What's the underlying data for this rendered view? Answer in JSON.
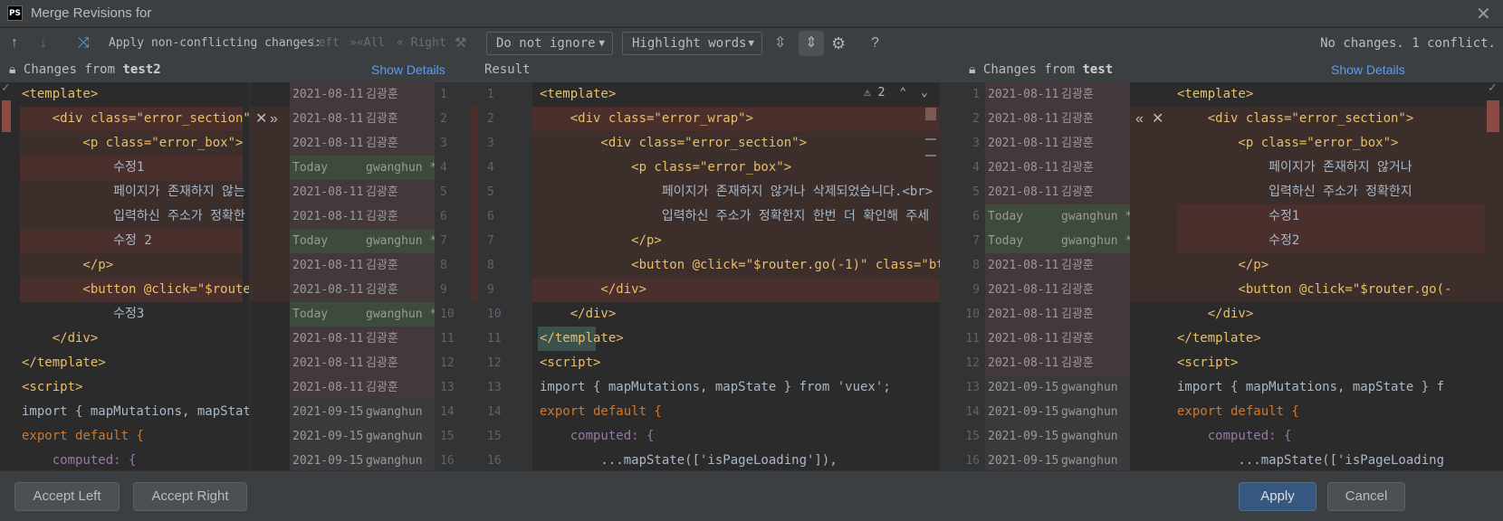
{
  "window": {
    "title": "Merge Revisions for",
    "app_icon": "PS"
  },
  "toolbar": {
    "apply_label": "Apply non-conflicting changes:",
    "left_label": "Left",
    "all_label": "All",
    "right_label": "Right",
    "ignore_combo": "Do not ignore",
    "highlight_combo": "Highlight words",
    "status": "No changes. 1 conflict."
  },
  "headers": {
    "left_prefix": "Changes from",
    "left_branch": "test2",
    "left_details": "Show Details",
    "result": "Result",
    "right_prefix": "Changes from",
    "right_branch": "test",
    "right_details": "Show Details"
  },
  "conflict_nav": {
    "count": "2"
  },
  "annotations_left": [
    {
      "date": "2021-08-11",
      "author": "김광훈",
      "line": "1"
    },
    {
      "date": "2021-08-11",
      "author": "김광훈",
      "line": "2"
    },
    {
      "date": "2021-08-11",
      "author": "김광훈",
      "line": "3"
    },
    {
      "date": "Today",
      "author": "gwanghun *",
      "line": "4"
    },
    {
      "date": "2021-08-11",
      "author": "김광훈",
      "line": "5"
    },
    {
      "date": "2021-08-11",
      "author": "김광훈",
      "line": "6"
    },
    {
      "date": "Today",
      "author": "gwanghun *",
      "line": "7"
    },
    {
      "date": "2021-08-11",
      "author": "김광훈",
      "line": "8"
    },
    {
      "date": "2021-08-11",
      "author": "김광훈",
      "line": "9"
    },
    {
      "date": "Today",
      "author": "gwanghun *",
      "line": "10"
    },
    {
      "date": "2021-08-11",
      "author": "김광훈",
      "line": "11"
    },
    {
      "date": "2021-08-11",
      "author": "김광훈",
      "line": "12"
    },
    {
      "date": "2021-08-11",
      "author": "김광훈",
      "line": "13"
    },
    {
      "date": "2021-09-15",
      "author": "gwanghun",
      "line": "14"
    },
    {
      "date": "2021-09-15",
      "author": "gwanghun",
      "line": "15"
    },
    {
      "date": "2021-09-15",
      "author": "gwanghun",
      "line": "16"
    }
  ],
  "annotations_right": [
    {
      "date": "2021-08-11",
      "author": "김광훈",
      "line": "1"
    },
    {
      "date": "2021-08-11",
      "author": "김광훈",
      "line": "2"
    },
    {
      "date": "2021-08-11",
      "author": "김광훈",
      "line": "3"
    },
    {
      "date": "2021-08-11",
      "author": "김광훈",
      "line": "4"
    },
    {
      "date": "2021-08-11",
      "author": "김광훈",
      "line": "5"
    },
    {
      "date": "Today",
      "author": "gwanghun *",
      "line": "6"
    },
    {
      "date": "Today",
      "author": "gwanghun *",
      "line": "7"
    },
    {
      "date": "2021-08-11",
      "author": "김광훈",
      "line": "8"
    },
    {
      "date": "2021-08-11",
      "author": "김광훈",
      "line": "9"
    },
    {
      "date": "2021-08-11",
      "author": "김광훈",
      "line": "10"
    },
    {
      "date": "2021-08-11",
      "author": "김광훈",
      "line": "11"
    },
    {
      "date": "2021-08-11",
      "author": "김광훈",
      "line": "12"
    },
    {
      "date": "2021-09-15",
      "author": "gwanghun",
      "line": "13"
    },
    {
      "date": "2021-09-15",
      "author": "gwanghun",
      "line": "14"
    },
    {
      "date": "2021-09-15",
      "author": "gwanghun",
      "line": "15"
    },
    {
      "date": "2021-09-15",
      "author": "gwanghun",
      "line": "16"
    }
  ],
  "result_line_numbers": [
    "1",
    "2",
    "3",
    "4",
    "5",
    "6",
    "7",
    "8",
    "9",
    "10",
    "11",
    "12",
    "13",
    "14",
    "15",
    "16"
  ],
  "code_left": [
    {
      "text": "<template>",
      "cls": "tag"
    },
    {
      "text": "    <div class=\"error_section\">",
      "cls": "tag"
    },
    {
      "text": "        <p class=\"error_box\">",
      "cls": "tag"
    },
    {
      "text": "            수정1",
      "cls": "txt"
    },
    {
      "text": "            페이지가 존재하지 않는",
      "cls": "txt"
    },
    {
      "text": "            입력하신 주소가 정확한",
      "cls": "txt"
    },
    {
      "text": "            수정 2",
      "cls": "txt"
    },
    {
      "text": "        </p>",
      "cls": "tag"
    },
    {
      "text": "        <button @click=\"$router.go",
      "cls": "tag"
    },
    {
      "text": "            수정3",
      "cls": "txt"
    },
    {
      "text": "    </div>",
      "cls": "tag"
    },
    {
      "text": "</template>",
      "cls": "tag"
    },
    {
      "text": "<script>",
      "cls": "tag"
    },
    {
      "text": "import { mapMutations, mapState }",
      "cls": "txt"
    },
    {
      "text": "export default {",
      "cls": "kw"
    },
    {
      "text": "    computed: {",
      "cls": "prop"
    }
  ],
  "code_result": [
    {
      "text": "<template>",
      "cls": "tag"
    },
    {
      "text": "    <div class=\"error_wrap\">",
      "cls": "tag"
    },
    {
      "text": "        <div class=\"error_section\">",
      "cls": "tag"
    },
    {
      "text": "            <p class=\"error_box\">",
      "cls": "tag"
    },
    {
      "text": "                페이지가 존재하지 않거나 삭제되었습니다.<br>",
      "cls": "txt"
    },
    {
      "text": "                입력하신 주소가 정확한지 한번 더 확인해 주세",
      "cls": "txt"
    },
    {
      "text": "            </p>",
      "cls": "tag"
    },
    {
      "text": "            <button @click=\"$router.go(-1)\" class=\"btn_back",
      "cls": "tag"
    },
    {
      "text": "        </div>",
      "cls": "tag"
    },
    {
      "text": "    </div>",
      "cls": "tag"
    },
    {
      "text": "</template>",
      "cls": "tag"
    },
    {
      "text": "<script>",
      "cls": "tag"
    },
    {
      "text": "import { mapMutations, mapState } from 'vuex';",
      "cls": "txt"
    },
    {
      "text": "export default {",
      "cls": "kw"
    },
    {
      "text": "    computed: {",
      "cls": "prop"
    },
    {
      "text": "        ...mapState(['isPageLoading']),",
      "cls": "txt"
    }
  ],
  "code_right": [
    {
      "text": "<template>",
      "cls": "tag"
    },
    {
      "text": "    <div class=\"error_section\">",
      "cls": "tag"
    },
    {
      "text": "        <p class=\"error_box\">",
      "cls": "tag"
    },
    {
      "text": "            페이지가 존재하지 않거나",
      "cls": "txt"
    },
    {
      "text": "            입력하신 주소가 정확한지",
      "cls": "txt"
    },
    {
      "text": "            수정1",
      "cls": "txt"
    },
    {
      "text": "            수정2",
      "cls": "txt"
    },
    {
      "text": "        </p>",
      "cls": "tag"
    },
    {
      "text": "        <button @click=\"$router.go(-",
      "cls": "tag"
    },
    {
      "text": "    </div>",
      "cls": "tag"
    },
    {
      "text": "</template>",
      "cls": "tag"
    },
    {
      "text": "<script>",
      "cls": "tag"
    },
    {
      "text": "import { mapMutations, mapState } f",
      "cls": "txt"
    },
    {
      "text": "export default {",
      "cls": "kw"
    },
    {
      "text": "    computed: {",
      "cls": "prop"
    },
    {
      "text": "        ...mapState(['isPageLoading",
      "cls": "txt"
    }
  ],
  "footer": {
    "accept_left": "Accept Left",
    "accept_right": "Accept Right",
    "apply": "Apply",
    "cancel": "Cancel"
  },
  "colors": {
    "conflict_bg": "#4a2f2c",
    "modified_bg": "#3a3f35",
    "accent": "#589df6"
  }
}
